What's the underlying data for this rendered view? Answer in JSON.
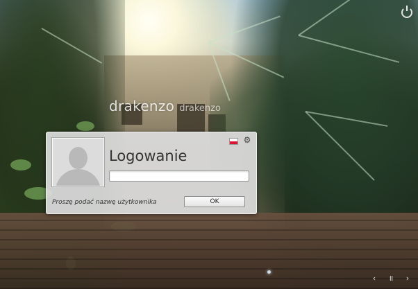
{
  "session": {
    "display_name": "drakenzo",
    "login_name": "drakenzo"
  },
  "dialog": {
    "title": "Logowanie",
    "username_value": "",
    "prompt": "Proszę podać nazwę użytkownika",
    "ok_label": "OK",
    "language_flag": "poland-flag-icon"
  },
  "icons": {
    "power": "power-icon",
    "settings": "gear-icon",
    "previous": "chevron-left-icon",
    "pause": "pause-icon",
    "next": "chevron-right-icon"
  },
  "glyphs": {
    "gear": "⚙",
    "previous": "‹",
    "pause": "॥",
    "next": "›"
  },
  "colors": {
    "dialog_bg": "#dcdcdc",
    "flag_white": "#ffffff",
    "flag_red": "#dc1431"
  }
}
